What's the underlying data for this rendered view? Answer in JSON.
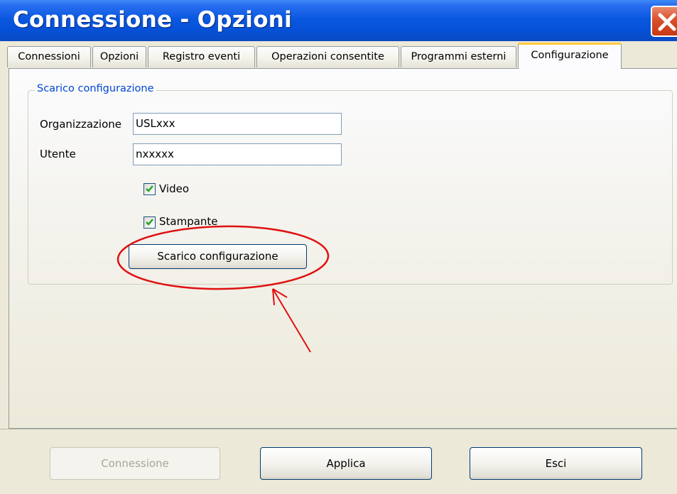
{
  "window": {
    "title": "Connessione - Opzioni",
    "close_icon": "close-icon"
  },
  "tabs": [
    {
      "label": "Connessioni",
      "active": false
    },
    {
      "label": "Opzioni",
      "active": false
    },
    {
      "label": "Registro eventi",
      "active": false
    },
    {
      "label": "Operazioni consentite",
      "active": false
    },
    {
      "label": "Programmi esterni",
      "active": false
    },
    {
      "label": "Configurazione",
      "active": true
    }
  ],
  "groupbox": {
    "title": "Scarico configurazione",
    "organization": {
      "label": "Organizzazione",
      "value": "USLxxx"
    },
    "user": {
      "label": "Utente",
      "value": "nxxxxx"
    },
    "video": {
      "label": "Video",
      "checked": true
    },
    "printer": {
      "label": "Stampante",
      "checked": true
    },
    "download_button": "Scarico configurazione"
  },
  "annotation": {
    "color": "#e01010",
    "shapes": [
      "ellipse",
      "arrow"
    ]
  },
  "footer": {
    "connect_button": {
      "label": "Connessione",
      "enabled": false
    },
    "apply_button": {
      "label": "Applica",
      "enabled": true
    },
    "exit_button": {
      "label": "Esci",
      "enabled": true
    }
  },
  "colors": {
    "titlebar": "#0a58e0",
    "window_bg": "#ece9d8",
    "group_title": "#0046d5",
    "active_tab_accent": "#ffc83c"
  }
}
